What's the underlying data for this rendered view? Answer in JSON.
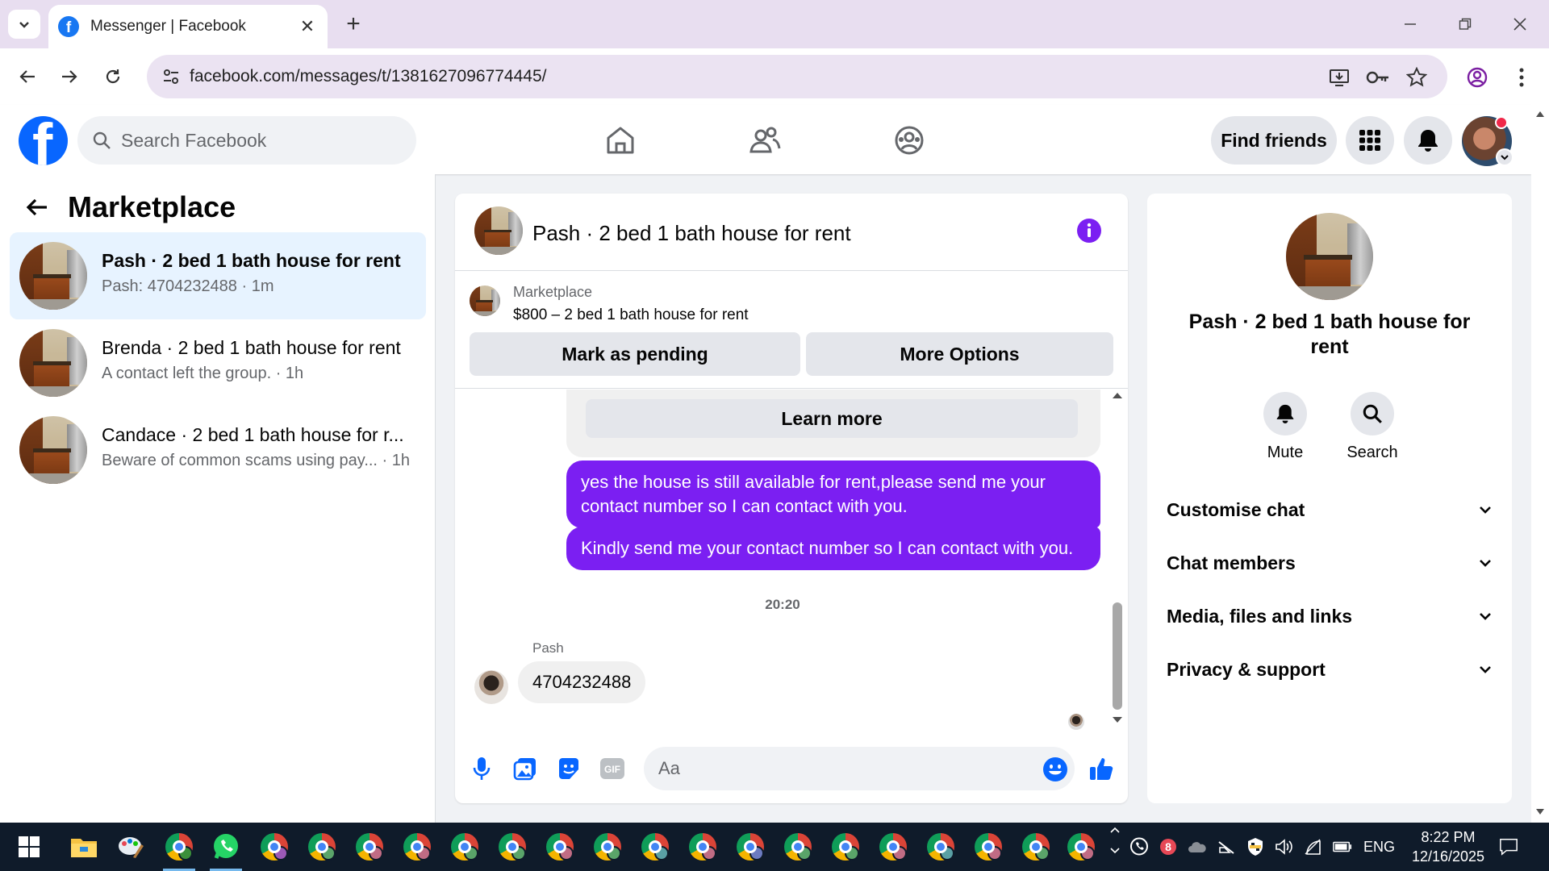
{
  "browser": {
    "tab_title": "Messenger | Facebook",
    "url": "facebook.com/messages/t/1381627096774445/"
  },
  "fb": {
    "search_placeholder": "Search Facebook",
    "find_friends": "Find friends"
  },
  "left": {
    "title": "Marketplace",
    "conversations": [
      {
        "title": "Pash · 2 bed 1 bath house for rent",
        "subtitle": "Pash: 4704232488 · 1m",
        "active": true
      },
      {
        "title": "Brenda · 2 bed 1 bath house for rent",
        "subtitle": "A contact left the group. · 1h",
        "active": false
      },
      {
        "title": "Candace · 2 bed 1 bath house for r...",
        "subtitle": "Beware of common scams using pay...   · 1h",
        "active": false
      }
    ]
  },
  "chat": {
    "title": "Pash · 2 bed 1 bath house for rent",
    "listing_source": "Marketplace",
    "listing_price": "$800 – 2 bed 1 bath house for rent",
    "mark_pending": "Mark as pending",
    "more_options": "More Options",
    "learn_more": "Learn more",
    "outgoing": [
      "yes the house is still available for rent,please send me your contact number so I can contact with you.",
      "Kindly send me your contact number so I can contact with you."
    ],
    "time_separator": "20:20",
    "sender_name": "Pash",
    "incoming": "4704232488",
    "input_placeholder": "Aa"
  },
  "right": {
    "name": "Pash · 2 bed 1 bath house for rent",
    "mute": "Mute",
    "search": "Search",
    "sections": [
      "Customise chat",
      "Chat members",
      "Media, files and links",
      "Privacy & support"
    ]
  },
  "taskbar": {
    "lang": "ENG",
    "time": "8:22 PM",
    "date": "12/16/2025"
  },
  "colors": {
    "fb_blue": "#0866ff",
    "bubble_purple": "#7b1ff2",
    "active_conv": "#e7f3ff"
  }
}
